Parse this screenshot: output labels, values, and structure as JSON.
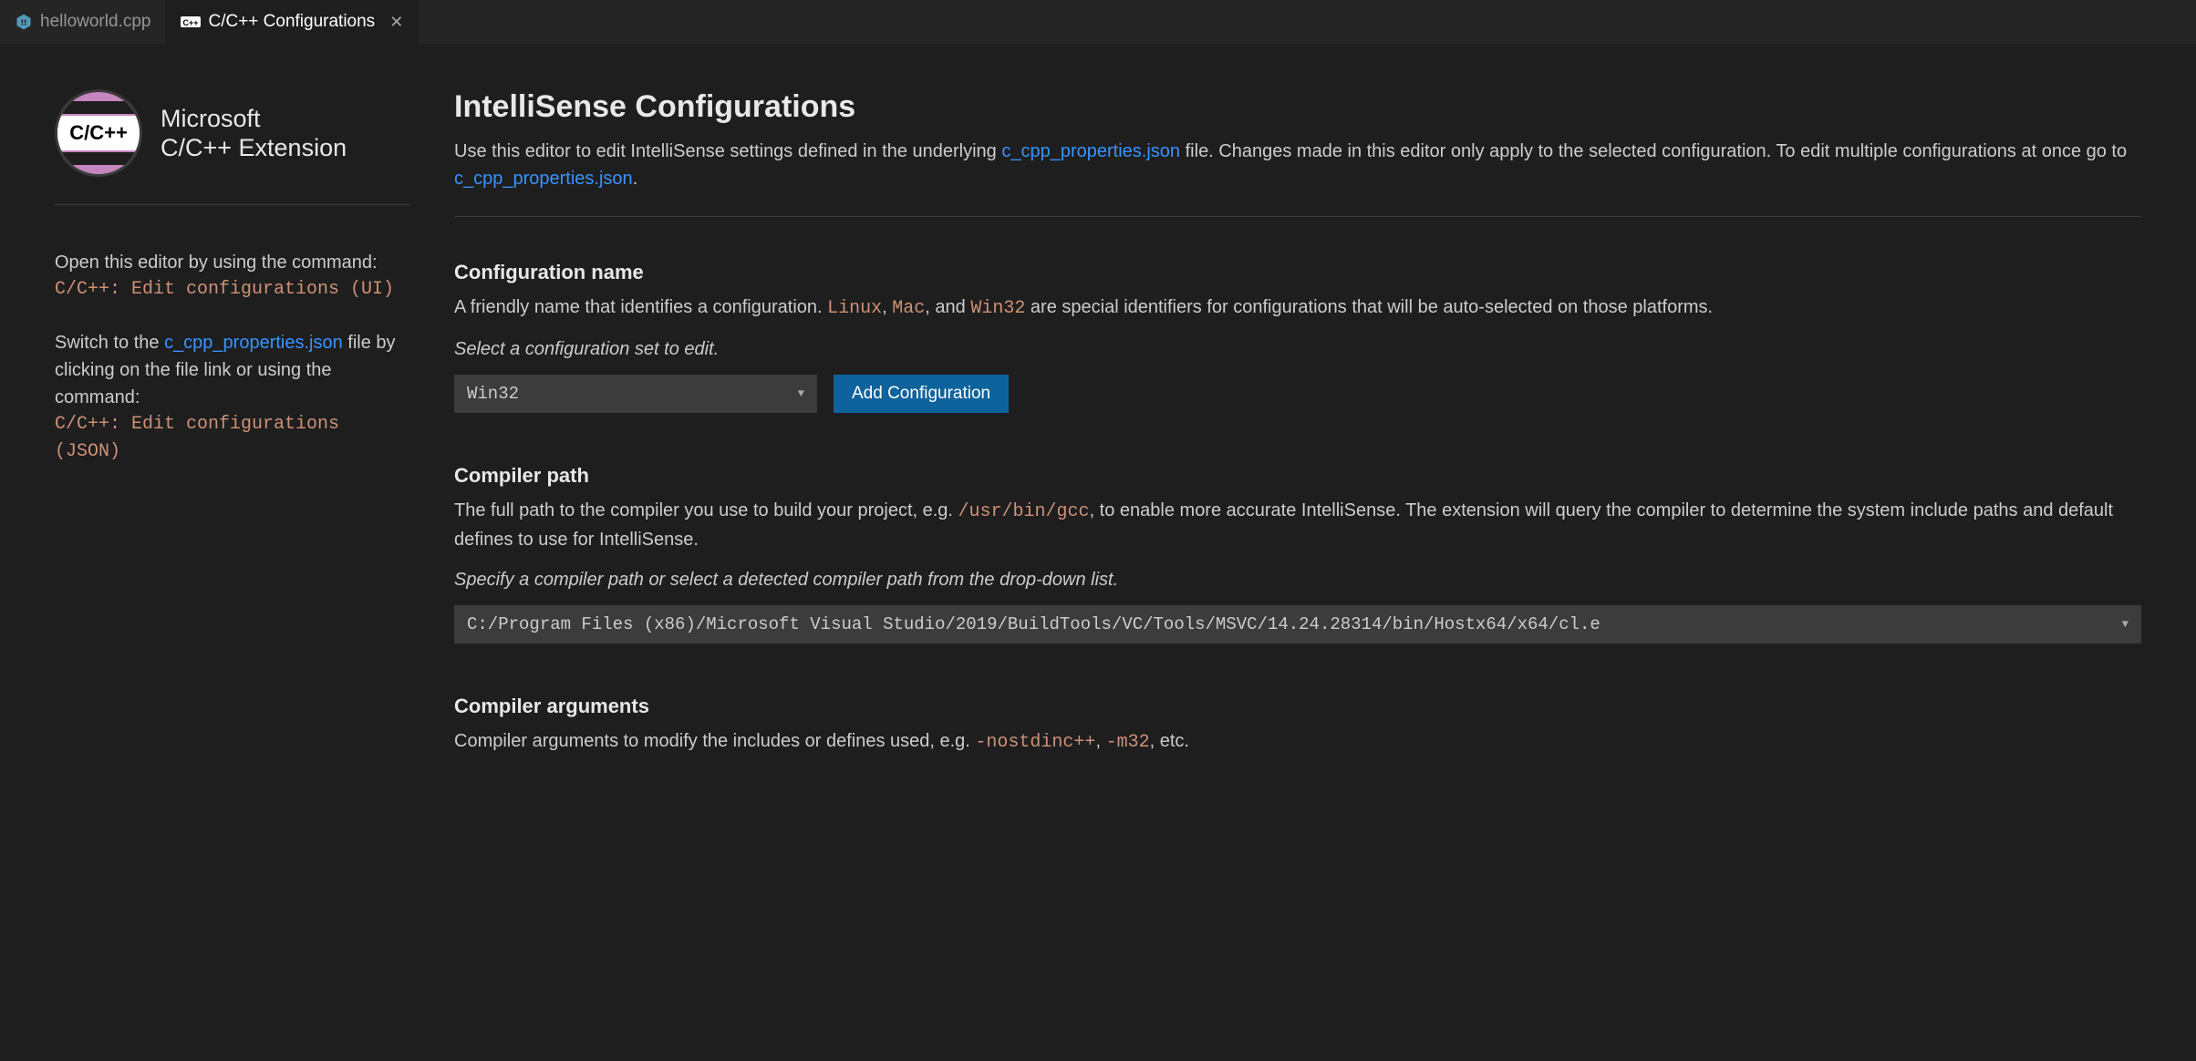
{
  "tabs": {
    "file": "helloworld.cpp",
    "config": "C/C++ Configurations"
  },
  "sidebar": {
    "logo_badge": "C/C++",
    "brand_line1": "Microsoft",
    "brand_line2": "C/C++ Extension",
    "open_editor_text": "Open this editor by using the command:",
    "open_editor_cmd": "C/C++: Edit configurations (UI)",
    "switch_prefix": "Switch to the ",
    "switch_link": "c_cpp_properties.json",
    "switch_suffix": " file by clicking on the file link or using the command:",
    "switch_cmd": "C/C++: Edit configurations (JSON)"
  },
  "main": {
    "title": "IntelliSense Configurations",
    "intro_prefix": "Use this editor to edit IntelliSense settings defined in the underlying ",
    "intro_link1": "c_cpp_properties.json",
    "intro_mid": " file. Changes made in this editor only apply to the selected configuration. To edit multiple configurations at once go to ",
    "intro_link2": "c_cpp_properties.json",
    "intro_suffix": "."
  },
  "config_name": {
    "heading": "Configuration name",
    "desc_prefix": "A friendly name that identifies a configuration. ",
    "kw1": "Linux",
    "sep1": ", ",
    "kw2": "Mac",
    "sep2": ", and ",
    "kw3": "Win32",
    "desc_suffix": " are special identifiers for configurations that will be auto-selected on those platforms.",
    "instruction": "Select a configuration set to edit.",
    "select_value": "Win32",
    "add_button": "Add Configuration"
  },
  "compiler_path": {
    "heading": "Compiler path",
    "desc_prefix": "The full path to the compiler you use to build your project, e.g. ",
    "example": "/usr/bin/gcc",
    "desc_suffix": ", to enable more accurate IntelliSense. The extension will query the compiler to determine the system include paths and default defines to use for IntelliSense.",
    "instruction": "Specify a compiler path or select a detected compiler path from the drop-down list.",
    "value": "C:/Program Files (x86)/Microsoft Visual Studio/2019/BuildTools/VC/Tools/MSVC/14.24.28314/bin/Hostx64/x64/cl.e"
  },
  "compiler_args": {
    "heading": "Compiler arguments",
    "desc_prefix": "Compiler arguments to modify the includes or defines used, e.g. ",
    "ex1": "-nostdinc++",
    "sep": ", ",
    "ex2": "-m32",
    "desc_suffix": ", etc."
  }
}
